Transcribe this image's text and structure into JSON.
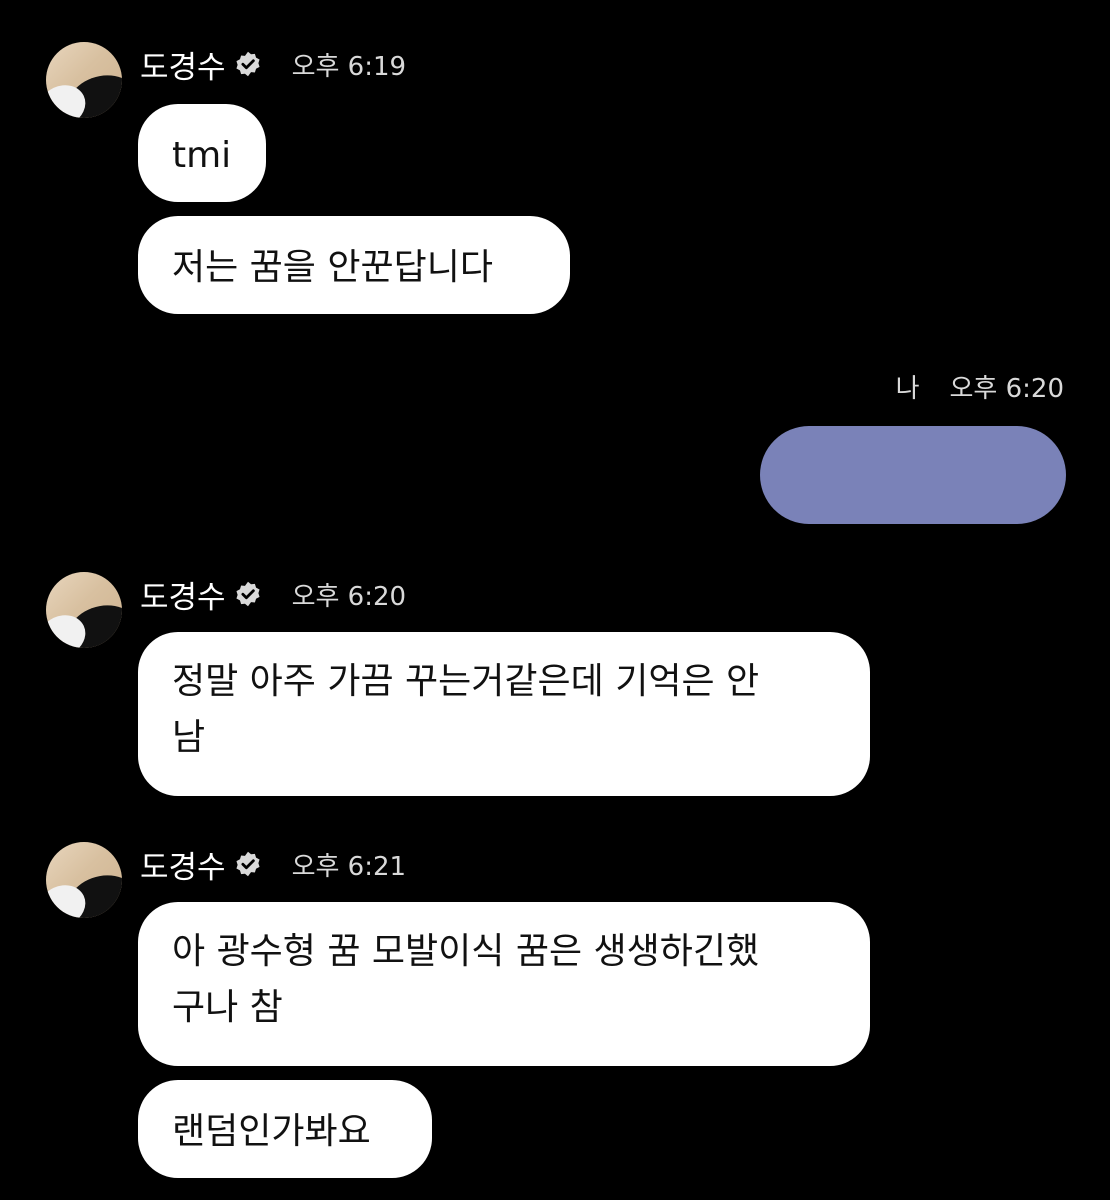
{
  "chat": {
    "messages": [
      {
        "sender": "도경수",
        "time": "오후 6:19",
        "bubbles": [
          "tmi",
          "저는 꿈을 안꾼답니다"
        ]
      },
      {
        "sender": "나",
        "time": "오후 6:20",
        "bubbles": [
          ""
        ]
      },
      {
        "sender": "도경수",
        "time": "오후 6:20",
        "bubbles": [
          "정말 아주 가끔 꾸는거같은데 기억은 안\n남"
        ]
      },
      {
        "sender": "도경수",
        "time": "오후 6:21",
        "bubbles": [
          "아 광수형 꿈 모발이식 꿈은 생생하긴했\n구나 참",
          "랜덤인가봐요"
        ]
      }
    ]
  },
  "colors": {
    "background": "#000000",
    "incoming_bubble": "#ffffff",
    "outgoing_bubble": "#7a82b8",
    "verified_badge": "#d9d9d9"
  },
  "icons": {
    "verified": "verified-badge-icon"
  }
}
